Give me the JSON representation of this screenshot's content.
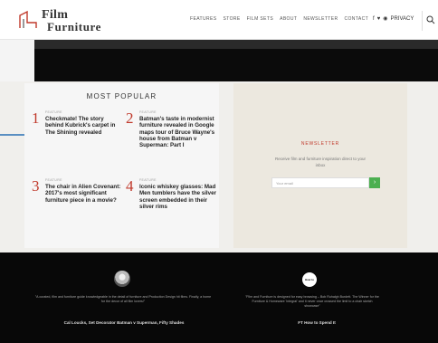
{
  "logo": {
    "line1": "Film",
    "line2": "Furniture"
  },
  "nav": [
    "FEATURES",
    "STORE",
    "FILM SETS",
    "ABOUT",
    "NEWSLETTER",
    "CONTACT"
  ],
  "social": {
    "icons": [
      "facebook-icon",
      "twitter-icon",
      "instagram-icon"
    ],
    "label": "PRIVACY"
  },
  "popular": {
    "title": "MOST POPULAR",
    "items": [
      {
        "num": "1",
        "cat": "FEATURE",
        "title": "Checkmate! The story behind Kubrick's carpet in The Shining revealed"
      },
      {
        "num": "2",
        "cat": "FEATURE",
        "title": "Batman's taste in modernist furniture revealed in Google maps tour of Bruce Wayne's house from Batman v Superman: Part I"
      },
      {
        "num": "3",
        "cat": "FEATURE",
        "title": "The chair in Alien Covenant: 2017's most significant furniture piece in a movie?"
      },
      {
        "num": "4",
        "cat": "FEATURE",
        "title": "Iconic whiskey glasses: Mad Men tumblers have the silver screen embedded in their silver rims"
      }
    ]
  },
  "newsletter": {
    "title": "NEWSLETTER",
    "text": "Receive film and furniture inspiration direct to your inbox",
    "placeholder": "Your email",
    "button": "›"
  },
  "testimonials": [
    {
      "quote": "\"A curated, film and furniture guide knowledgeable in the detail of furniture and Production Design hit films. Finally, a home for the decor of all film lovers!\"",
      "attr": "Cal Loucks, Set Decorator Batman v Superman, Fifty Shades"
    },
    {
      "quote": "\"Film and Furniture is designed for easy browsing – Bob Ruhalgh Burdett. The Winner for the Furniture & Homeware 'integral' and it never once crossed the limit to a chair sketch showcase\"",
      "attr": "FT How to Spend It",
      "badge": "How to Spend It"
    }
  ]
}
